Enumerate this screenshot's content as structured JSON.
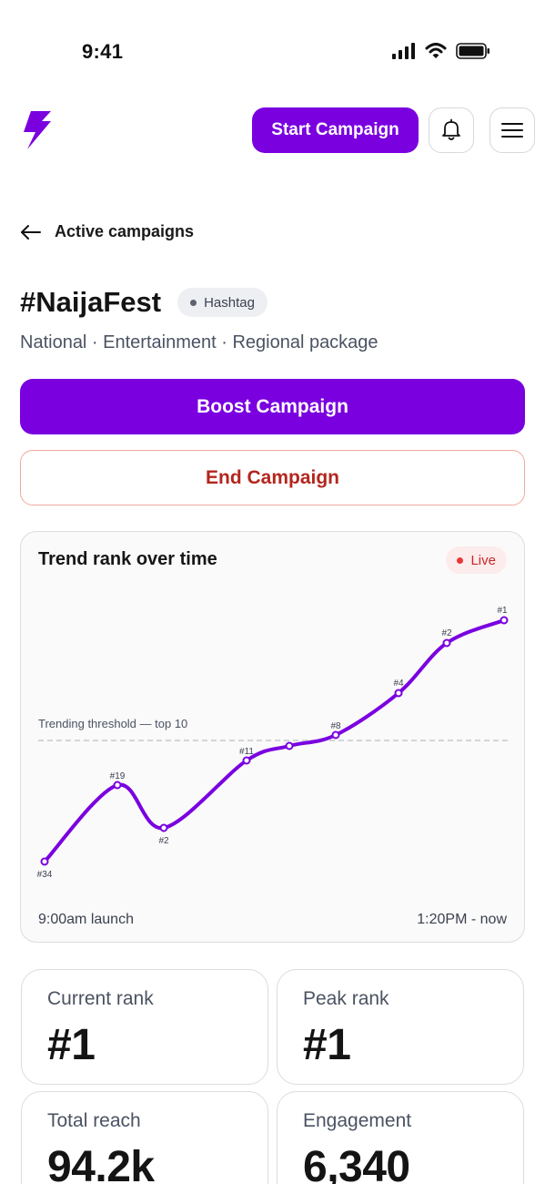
{
  "status_bar": {
    "time": "9:41"
  },
  "header": {
    "start_campaign_label": "Start Campaign"
  },
  "back": {
    "label": "Active campaigns"
  },
  "campaign": {
    "title": "#NaijaFest",
    "type_badge": "Hashtag",
    "subtitle": "National · Entertainment · Regional package"
  },
  "actions": {
    "boost_label": "Boost Campaign",
    "end_label": "End Campaign"
  },
  "chart": {
    "title": "Trend rank over time",
    "live_label": "Live",
    "threshold_label": "Trending threshold — top 10",
    "x_start_label": "9:00am launch",
    "x_end_label": "1:20PM - now"
  },
  "chart_data": {
    "type": "line",
    "title": "Trend rank over time",
    "x": [
      "9:00am launch",
      "",
      "",
      "",
      "",
      "",
      "",
      "",
      "1:20PM - now"
    ],
    "series": [
      {
        "values": [
          34,
          19,
          2,
          11,
          8,
          8,
          4,
          2,
          1
        ],
        "point_labels": [
          "#34",
          "#19",
          "#2",
          "#11",
          "",
          "#8",
          "#4",
          "#2",
          "#1"
        ]
      }
    ],
    "threshold": {
      "label": "Trending threshold — top 10",
      "rank": 10
    },
    "grid": false,
    "accent_color": "#7a00e0"
  },
  "stats": {
    "current_rank": {
      "label": "Current rank",
      "value": "#1"
    },
    "peak_rank": {
      "label": "Peak rank",
      "value": "#1"
    },
    "total_reach": {
      "label": "Total reach",
      "value": "94.2k"
    },
    "engagement": {
      "label": "Engagement",
      "value": "6,340"
    }
  },
  "colors": {
    "brand": "#7a00e0",
    "danger": "#b3261e",
    "live": "#e53935"
  }
}
